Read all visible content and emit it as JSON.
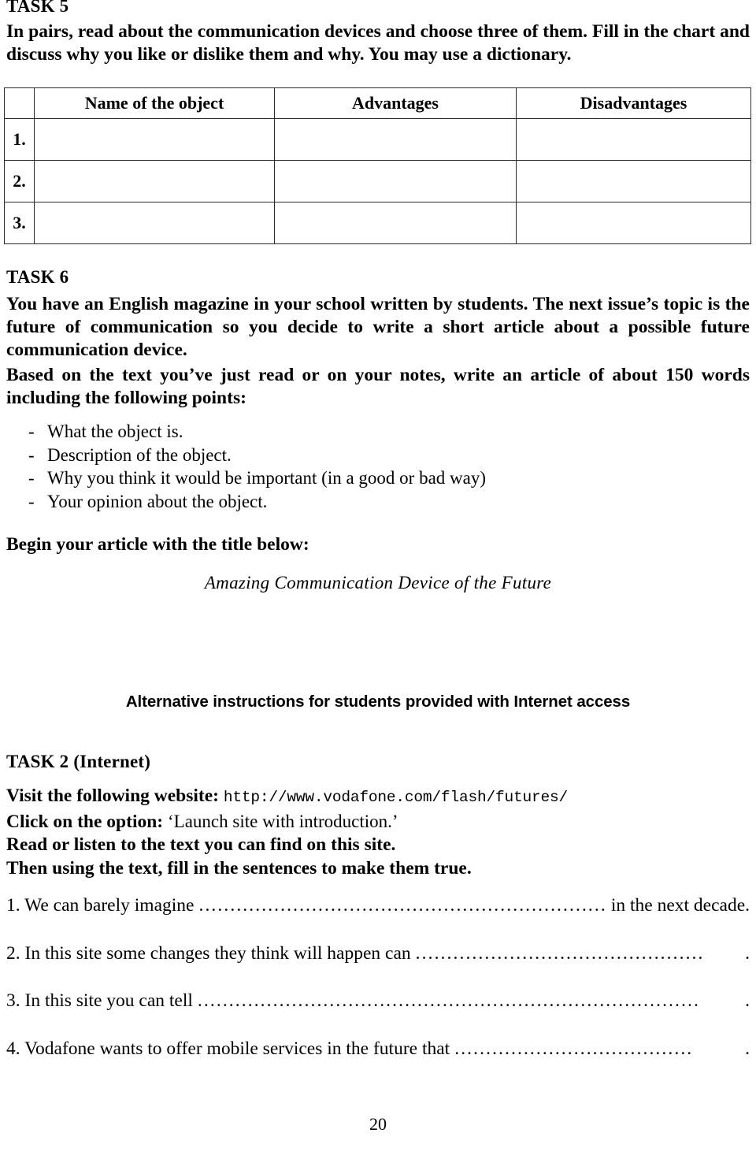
{
  "task5": {
    "label": "TASK 5",
    "instructions": "In pairs, read about the communication devices and choose three of them. Fill in the chart and discuss why you like or dislike them and why.  You may use a dictionary."
  },
  "table": {
    "headers": [
      "",
      "Name of the object",
      "Advantages",
      "Disadvantages"
    ],
    "rows": [
      {
        "index": "1.",
        "name": "",
        "advantages": "",
        "disadvantages": ""
      },
      {
        "index": "2.",
        "name": "",
        "advantages": "",
        "disadvantages": ""
      },
      {
        "index": "3.",
        "name": "",
        "advantages": "",
        "disadvantages": ""
      }
    ]
  },
  "task6": {
    "label": "TASK 6",
    "paragraph1": "You have an English magazine in your school written by students. The next issue’s topic is the future of communication so you decide to write a short article about a possible future communication device.",
    "paragraph2": "Based on the text you’ve just read or on your notes, write an article of about 150 words including the following points:",
    "dash": "-",
    "points": [
      "What the object is.",
      "Description of the object.",
      "Why you think it would be important (in a good or bad way)",
      "Your opinion about the object."
    ],
    "begin_line": "Begin your article with the title below:",
    "article_title": "Amazing Communication Device of the Future"
  },
  "alternative": {
    "heading": "Alternative instructions for students provided with Internet access"
  },
  "task2": {
    "label": "TASK 2 (Internet)",
    "line1_prefix": "Visit the following website:",
    "line1_url": "http://www.vodafone.com/flash/futures/",
    "line2_prefix": "Click on the option:",
    "line2_quoted": "‘Launch site with introduction.’",
    "line3": "Read or listen to the text you can find on this site.",
    "line4": "Then using the text, fill in the sentences to make them true."
  },
  "fill_sentences": [
    {
      "pre": "1. We can barely imagine",
      "leader": "....................................................................",
      "post": "in the next decade."
    },
    {
      "pre": "2. In this site some changes they think will happen can",
      "leader": "..............................................",
      "post": "."
    },
    {
      "pre": "3. In this site you can tell",
      "leader": "................................................................................",
      "post": "."
    },
    {
      "pre": "4. Vodafone wants to offer mobile services in the future that",
      "leader": "......................................",
      "post": "."
    }
  ],
  "footer": {
    "page_number": "20"
  }
}
